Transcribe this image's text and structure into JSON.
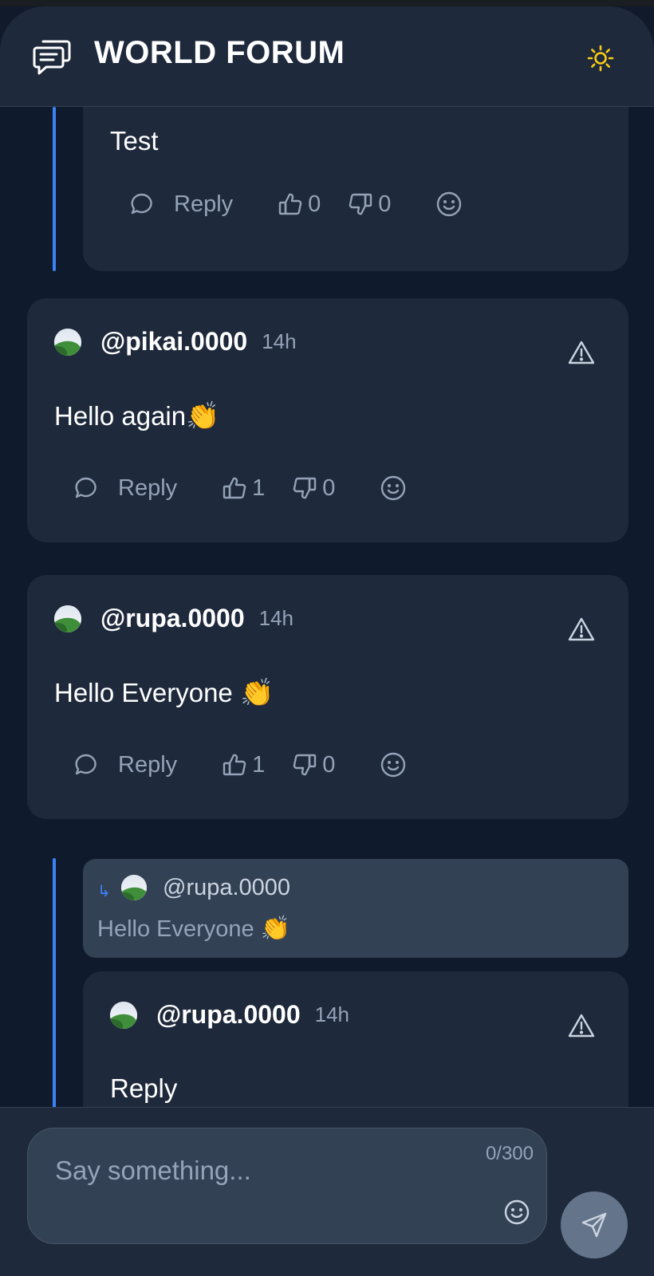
{
  "header": {
    "title": "WORLD FORUM",
    "logo_icon": "chat-bubbles-icon",
    "theme_icon": "sun-icon"
  },
  "colors": {
    "accent": "#3b82f6",
    "card": "#1e293b",
    "background": "#0f1a2c",
    "muted": "#94a3b8",
    "sun": "#facc15"
  },
  "posts": [
    {
      "text": "Test",
      "reply_label": "Reply",
      "likes": "0",
      "dislikes": "0"
    },
    {
      "username": "@pikai.0000",
      "time": "14h",
      "text": "Hello again",
      "emoji": "👏",
      "reply_label": "Reply",
      "likes": "1",
      "dislikes": "0"
    },
    {
      "username": "@rupa.0000",
      "time": "14h",
      "text": "Hello Everyone ",
      "emoji": "👏",
      "reply_label": "Reply",
      "likes": "1",
      "dislikes": "0"
    },
    {
      "quote": {
        "arrow": "↳",
        "username": "@rupa.0000",
        "text": "Hello Everyone ",
        "emoji": "👏"
      },
      "username": "@rupa.0000",
      "time": "14h",
      "text": "Reply"
    }
  ],
  "composer": {
    "placeholder": "Say something...",
    "counter": "0/300",
    "emoji_icon": "smiley-icon",
    "send_icon": "send-icon"
  }
}
